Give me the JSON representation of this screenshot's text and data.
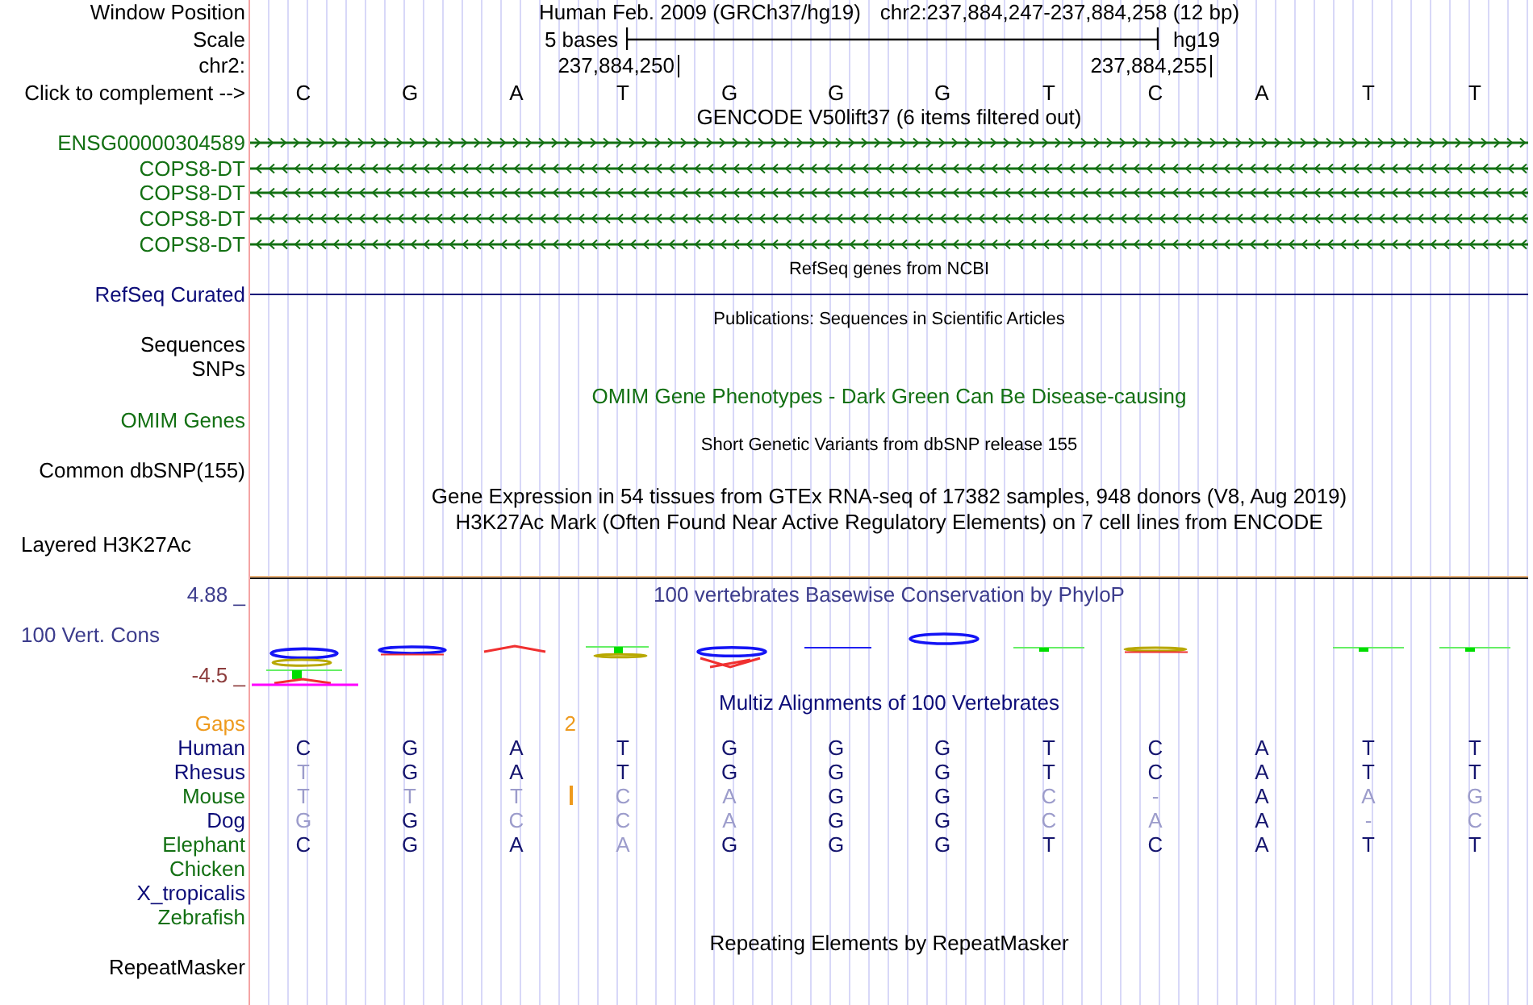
{
  "position": {
    "label": "Window Position",
    "assembly": "Human Feb. 2009 (GRCh37/hg19)",
    "range": "chr2:237,884,247-237,884,258 (12 bp)"
  },
  "scale": {
    "label": "Scale",
    "length": "5 bases",
    "assembly": "hg19"
  },
  "chromosome": {
    "label": "chr2:"
  },
  "sequence": {
    "label": "Click to complement -->",
    "bases": [
      {
        "base": "C"
      },
      {
        "base": "G"
      },
      {
        "base": "A"
      },
      {
        "base": "T",
        "coordinate": "237,884,250"
      },
      {
        "base": "G"
      },
      {
        "base": "G"
      },
      {
        "base": "G"
      },
      {
        "base": "T"
      },
      {
        "base": "C",
        "coordinate": "237,884,255"
      },
      {
        "base": "A"
      },
      {
        "base": "T"
      },
      {
        "base": "T"
      }
    ]
  },
  "tracks": [
    {
      "kind": "genes",
      "title": {
        "text": "GENCODE V50lift37 (6 items filtered out)",
        "color": "#000000"
      },
      "items": [
        {
          "label": "ENSG00000304589",
          "color": "#137013",
          "reverse": false
        },
        {
          "label": "COPS8-DT",
          "color": "#137013",
          "reverse": true
        },
        {
          "label": "COPS8-DT",
          "color": "#137013",
          "reverse": true
        },
        {
          "label": "COPS8-DT",
          "color": "#137013",
          "reverse": true
        },
        {
          "label": "COPS8-DT",
          "color": "#137013",
          "reverse": true
        }
      ]
    },
    {
      "kind": "line",
      "title": {
        "text": "RefSeq genes from NCBI",
        "color": "#000000"
      },
      "labels": [
        {
          "text": "RefSeq Curated",
          "color": "#0c0c78"
        }
      ]
    },
    {
      "kind": "dense",
      "title": {
        "text": "Publications: Sequences in Scientific Articles",
        "color": "#000000"
      },
      "labels": [
        {
          "text": "Sequences",
          "color": "#000000"
        },
        {
          "text": "SNPs",
          "color": "#000000"
        }
      ]
    },
    {
      "kind": "pack",
      "title": {
        "text": "OMIM Gene Phenotypes - Dark Green Can Be Disease-causing",
        "color": "#137013"
      },
      "labels": [
        {
          "text": "OMIM Genes",
          "color": "#137013"
        }
      ]
    },
    {
      "kind": "dense",
      "title": {
        "text": "Short Genetic Variants from dbSNP release 155",
        "color": "#000000"
      },
      "labels": [
        {
          "text": "Common dbSNP(155)",
          "color": "#000000"
        }
      ]
    },
    {
      "kind": "pack",
      "title": {
        "text": "Gene Expression in 54 tissues from GTEx RNA-seq of 17382 samples, 948 donors (V8, Aug 2019)",
        "color": "#000000"
      }
    },
    {
      "kind": "signal",
      "title": {
        "text": "H3K27Ac Mark (Often Found Near Active Regulatory Elements) on 7 cell lines from ENCODE",
        "color": "#000000"
      },
      "labels": [
        {
          "text": "Layered H3K27Ac",
          "color": "#000000"
        }
      ]
    },
    {
      "kind": "conservation",
      "title": {
        "text": "100 vertebrates Basewise Conservation by PhyloP",
        "color": "#3c3c8c"
      },
      "labels": [
        {
          "text": "100 Vert. Cons",
          "color": "#3c3c8c"
        }
      ],
      "max": {
        "text": "4.88 _",
        "color": "#3c3c8c"
      },
      "min": {
        "text": "-4.5 _",
        "color": "#8c3c3c"
      }
    },
    {
      "kind": "alignment",
      "title": {
        "text": "Multiz Alignments of 100 Vertebrates",
        "color": "#0c0c78"
      },
      "gaps": {
        "label": {
          "text": "Gaps",
          "color": "#ee9a1e"
        },
        "counts": [
          "2"
        ]
      },
      "species": [
        {
          "name": "Human",
          "color": "#0c0c78",
          "bases": [
            {
              "base": "C",
              "match": true,
              "insertion": false
            },
            {
              "base": "G",
              "match": true,
              "insertion": false
            },
            {
              "base": "A",
              "match": true,
              "insertion": false
            },
            {
              "base": "T",
              "match": true,
              "insertion": false
            },
            {
              "base": "G",
              "match": true,
              "insertion": false
            },
            {
              "base": "G",
              "match": true,
              "insertion": false
            },
            {
              "base": "G",
              "match": true,
              "insertion": false
            },
            {
              "base": "T",
              "match": true,
              "insertion": false
            },
            {
              "base": "C",
              "match": true,
              "insertion": false
            },
            {
              "base": "A",
              "match": true,
              "insertion": false
            },
            {
              "base": "T",
              "match": true,
              "insertion": false
            },
            {
              "base": "T",
              "match": true,
              "insertion": false
            }
          ]
        },
        {
          "name": "Rhesus",
          "color": "#0c0c78",
          "bases": [
            {
              "base": "T",
              "match": false,
              "insertion": false
            },
            {
              "base": "G",
              "match": true,
              "insertion": false
            },
            {
              "base": "A",
              "match": true,
              "insertion": false
            },
            {
              "base": "T",
              "match": true,
              "insertion": false
            },
            {
              "base": "G",
              "match": true,
              "insertion": false
            },
            {
              "base": "G",
              "match": true,
              "insertion": false
            },
            {
              "base": "G",
              "match": true,
              "insertion": false
            },
            {
              "base": "T",
              "match": true,
              "insertion": false
            },
            {
              "base": "C",
              "match": true,
              "insertion": false
            },
            {
              "base": "A",
              "match": true,
              "insertion": false
            },
            {
              "base": "T",
              "match": true,
              "insertion": false
            },
            {
              "base": "T",
              "match": true,
              "insertion": false
            }
          ]
        },
        {
          "name": "Mouse",
          "color": "#137013",
          "bases": [
            {
              "base": "T",
              "match": false,
              "insertion": false
            },
            {
              "base": "T",
              "match": false,
              "insertion": false
            },
            {
              "base": "T",
              "match": false,
              "insertion": true
            },
            {
              "base": "C",
              "match": false,
              "insertion": false
            },
            {
              "base": "A",
              "match": false,
              "insertion": false
            },
            {
              "base": "G",
              "match": true,
              "insertion": false
            },
            {
              "base": "G",
              "match": true,
              "insertion": false
            },
            {
              "base": "C",
              "match": false,
              "insertion": false
            },
            {
              "base": "-",
              "match": false,
              "insertion": false
            },
            {
              "base": "A",
              "match": true,
              "insertion": false
            },
            {
              "base": "A",
              "match": false,
              "insertion": false
            },
            {
              "base": "G",
              "match": false,
              "insertion": false
            }
          ]
        },
        {
          "name": "Dog",
          "color": "#0c0c78",
          "bases": [
            {
              "base": "G",
              "match": false,
              "insertion": false
            },
            {
              "base": "G",
              "match": true,
              "insertion": false
            },
            {
              "base": "C",
              "match": false,
              "insertion": false
            },
            {
              "base": "C",
              "match": false,
              "insertion": false
            },
            {
              "base": "A",
              "match": false,
              "insertion": false
            },
            {
              "base": "G",
              "match": true,
              "insertion": false
            },
            {
              "base": "G",
              "match": true,
              "insertion": false
            },
            {
              "base": "C",
              "match": false,
              "insertion": false
            },
            {
              "base": "A",
              "match": false,
              "insertion": false
            },
            {
              "base": "A",
              "match": true,
              "insertion": false
            },
            {
              "base": "-",
              "match": false,
              "insertion": false
            },
            {
              "base": "C",
              "match": false,
              "insertion": false
            }
          ]
        },
        {
          "name": "Elephant",
          "color": "#137013",
          "bases": [
            {
              "base": "C",
              "match": true,
              "insertion": false
            },
            {
              "base": "G",
              "match": true,
              "insertion": false
            },
            {
              "base": "A",
              "match": true,
              "insertion": false
            },
            {
              "base": "A",
              "match": false,
              "insertion": false
            },
            {
              "base": "G",
              "match": true,
              "insertion": false
            },
            {
              "base": "G",
              "match": true,
              "insertion": false
            },
            {
              "base": "G",
              "match": true,
              "insertion": false
            },
            {
              "base": "T",
              "match": true,
              "insertion": false
            },
            {
              "base": "C",
              "match": true,
              "insertion": false
            },
            {
              "base": "A",
              "match": true,
              "insertion": false
            },
            {
              "base": "T",
              "match": true,
              "insertion": false
            },
            {
              "base": "T",
              "match": true,
              "insertion": false
            }
          ]
        },
        {
          "name": "Chicken",
          "color": "#137013"
        },
        {
          "name": "X_tropicalis",
          "color": "#0c0c78"
        },
        {
          "name": "Zebrafish",
          "color": "#137013"
        }
      ]
    },
    {
      "kind": "pack",
      "title": {
        "text": "Repeating Elements by RepeatMasker",
        "color": "#000000"
      },
      "labels": [
        {
          "text": "RepeatMasker",
          "color": "#000000"
        }
      ]
    }
  ]
}
